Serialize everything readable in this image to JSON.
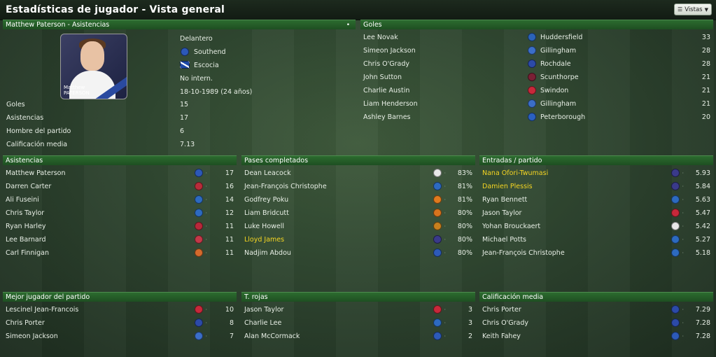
{
  "window": {
    "title": "Estadísticas de jugador - Vista general",
    "views_label": "Vistas"
  },
  "profile": {
    "header": "Matthew Paterson - Asistencias",
    "photo_caption_first": "Matthew",
    "photo_caption_last": "PATERSON",
    "position": "Delantero",
    "club": "Southend",
    "nation": "Escocia",
    "intl": "No intern.",
    "dob": "18-10-1989 (24 años)",
    "stats": [
      {
        "label": "Goles",
        "value": "15"
      },
      {
        "label": "Asistencias",
        "value": "17"
      },
      {
        "label": "Hombre del partido",
        "value": "6"
      },
      {
        "label": "Calificación media",
        "value": "7.13"
      }
    ]
  },
  "goals": {
    "header": "Goles",
    "rows": [
      {
        "name": "Lee Novak",
        "club": "Huddersfield",
        "value": "33",
        "color": "#2b63b8"
      },
      {
        "name": "Simeon Jackson",
        "club": "Gillingham",
        "value": "28",
        "color": "#3b6ec8"
      },
      {
        "name": "Chris O'Grady",
        "club": "Rochdale",
        "value": "28",
        "color": "#2c4aa8"
      },
      {
        "name": "John Sutton",
        "club": "Scunthorpe",
        "value": "21",
        "color": "#7a2035"
      },
      {
        "name": "Charlie Austin",
        "club": "Swindon",
        "value": "21",
        "color": "#c8283a"
      },
      {
        "name": "Liam Henderson",
        "club": "Gillingham",
        "value": "21",
        "color": "#3b6ec8"
      },
      {
        "name": "Ashley Barnes",
        "club": "Peterborough",
        "value": "20",
        "color": "#2a60c0"
      }
    ]
  },
  "assists": {
    "header": "Asistencias",
    "rows": [
      {
        "name": "Matthew Paterson",
        "value": "17",
        "color": "#2c58b8",
        "hl": false
      },
      {
        "name": "Darren Carter",
        "value": "16",
        "color": "#b82c3a",
        "hl": false
      },
      {
        "name": "Ali Fuseini",
        "value": "14",
        "color": "#2d6ac0",
        "hl": false
      },
      {
        "name": "Chris Taylor",
        "value": "12",
        "color": "#2d6ac0",
        "hl": false
      },
      {
        "name": "Ryan Harley",
        "value": "11",
        "color": "#b8283a",
        "hl": false
      },
      {
        "name": "Lee Barnard",
        "value": "11",
        "color": "#c43848",
        "hl": false
      },
      {
        "name": "Carl Finnigan",
        "value": "11",
        "color": "#d46a2c",
        "hl": false
      }
    ]
  },
  "passes": {
    "header": "Pases completados",
    "rows": [
      {
        "name": "Dean Leacock",
        "value": "83%",
        "color": "#e8e8e8",
        "hl": false
      },
      {
        "name": "Jean-François Christophe",
        "value": "81%",
        "color": "#2d6ac0",
        "hl": false
      },
      {
        "name": "Godfrey Poku",
        "value": "81%",
        "color": "#e07a1e",
        "hl": false
      },
      {
        "name": "Liam Bridcutt",
        "value": "80%",
        "color": "#d8741e",
        "hl": false
      },
      {
        "name": "Luke Howell",
        "value": "80%",
        "color": "#c8801e",
        "hl": false
      },
      {
        "name": "Lloyd James",
        "value": "80%",
        "color": "#3a3a8a",
        "hl": true
      },
      {
        "name": "Nadjim Abdou",
        "value": "80%",
        "color": "#2d5ab8",
        "hl": false
      }
    ]
  },
  "tackles": {
    "header": "Entradas / partido",
    "rows": [
      {
        "name": "Nana Ofori-Twumasi",
        "value": "5.93",
        "color": "#3a3a8a",
        "hl": true
      },
      {
        "name": "Damien Plessis",
        "value": "5.84",
        "color": "#3a3a8a",
        "hl": true
      },
      {
        "name": "Ryan Bennett",
        "value": "5.63",
        "color": "#2d6ac0",
        "hl": false
      },
      {
        "name": "Jason Taylor",
        "value": "5.47",
        "color": "#c8283a",
        "hl": false
      },
      {
        "name": "Yohan Brouckaert",
        "value": "5.42",
        "color": "#e8e8e8",
        "hl": false
      },
      {
        "name": "Michael Potts",
        "value": "5.27",
        "color": "#2d6ac0",
        "hl": false
      },
      {
        "name": "Jean-François Christophe",
        "value": "5.18",
        "color": "#2d6ac0",
        "hl": false
      }
    ]
  },
  "motm": {
    "header": "Mejor jugador del partido",
    "rows": [
      {
        "name": "Lescinel Jean-Francois",
        "value": "10",
        "color": "#c8283a",
        "hl": false
      },
      {
        "name": "Chris Porter",
        "value": "8",
        "color": "#2c4aa8",
        "hl": false
      },
      {
        "name": "Simeon Jackson",
        "value": "7",
        "color": "#3b6ec8",
        "hl": false
      }
    ]
  },
  "reds": {
    "header": "T. rojas",
    "rows": [
      {
        "name": "Jason Taylor",
        "value": "3",
        "color": "#c8283a",
        "hl": false
      },
      {
        "name": "Charlie Lee",
        "value": "3",
        "color": "#2d6ac0",
        "hl": false
      },
      {
        "name": "Alan McCormack",
        "value": "2",
        "color": "#2d5ab8",
        "hl": false
      }
    ]
  },
  "rating": {
    "header": "Calificación media",
    "rows": [
      {
        "name": "Chris Porter",
        "value": "7.29",
        "color": "#2c4aa8",
        "hl": false
      },
      {
        "name": "Chris O'Grady",
        "value": "7.28",
        "color": "#2c4aa8",
        "hl": false
      },
      {
        "name": "Keith Fahey",
        "value": "7.28",
        "color": "#2d5ab8",
        "hl": false
      }
    ]
  }
}
